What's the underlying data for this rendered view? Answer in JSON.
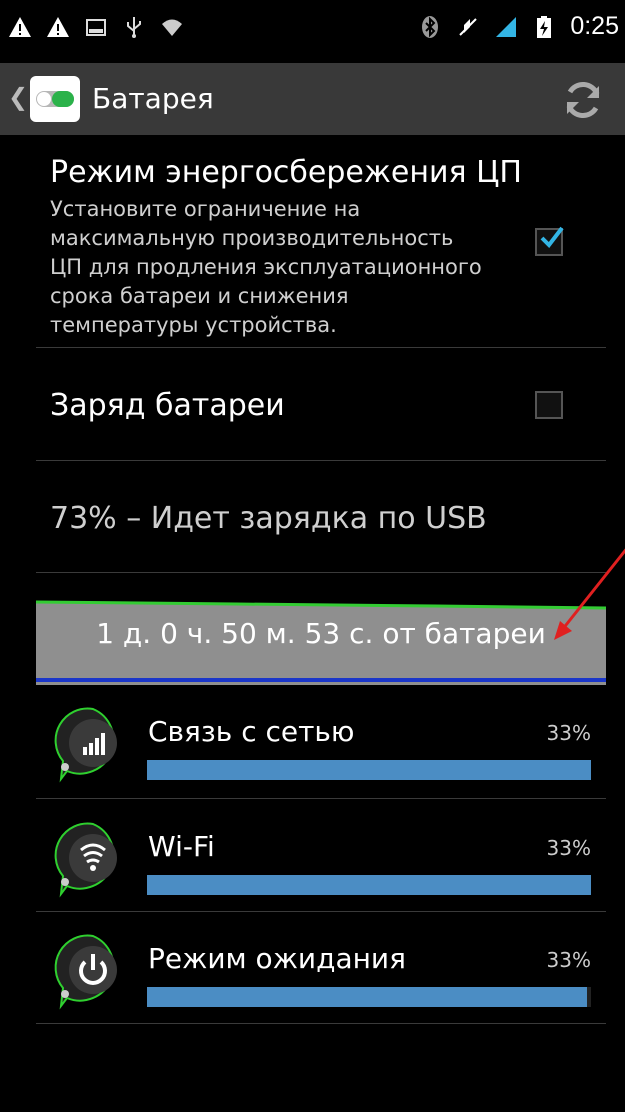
{
  "status_bar": {
    "time": "0:25",
    "left_icons": [
      "warning-icon",
      "warning-icon",
      "image-icon",
      "usb-icon",
      "wifi-icon"
    ],
    "right_icons": [
      "bluetooth-icon",
      "mute-icon",
      "signal-icon",
      "battery-charging-icon"
    ]
  },
  "action_bar": {
    "back_icon": "back-caret-icon",
    "app_icon": "toggle-settings-icon",
    "title": "Батарея",
    "refresh_icon": "refresh-icon"
  },
  "prefs": {
    "power_saving": {
      "title": "Режим энергосбережения ЦП",
      "summary": "Установите ограничение на максимальную производительность ЦП для продления эксплуатационного срока батареи и снижения температуры устройства.",
      "checked": true
    },
    "battery_charge": {
      "title": "Заряд батареи",
      "checked": false
    },
    "charging_status": {
      "title": "73% – Идет зарядка по USB"
    }
  },
  "graph": {
    "label": "1 д. 0 ч. 50 м. 53 с. от батареи"
  },
  "usage_items": [
    {
      "name": "Связь с сетью",
      "percent_text": "33%",
      "percent": 0.33,
      "fill_fraction": 1.0,
      "icon": "cell-signal-icon"
    },
    {
      "name": "Wi-Fi",
      "percent_text": "33%",
      "percent": 0.33,
      "fill_fraction": 1.0,
      "icon": "wifi-icon"
    },
    {
      "name": "Режим ожидания",
      "percent_text": "33%",
      "percent": 0.33,
      "fill_fraction": 0.99,
      "icon": "power-icon"
    }
  ],
  "colors": {
    "accent_blue": "#33b5e5",
    "usage_bar": "#4b8dc4",
    "graph_bg": "#8f8f8f",
    "graph_line": "#33cc33",
    "annotation_arrow": "#e02020"
  }
}
